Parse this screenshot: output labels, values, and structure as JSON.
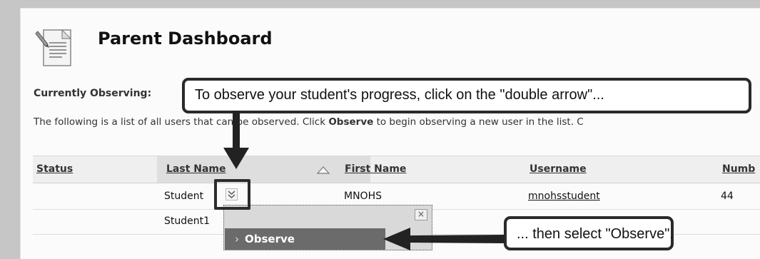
{
  "header": {
    "title": "Parent Dashboard",
    "icon": "document-icon"
  },
  "observing": {
    "label": "Currently Observing:"
  },
  "instructions": {
    "prefix": "The following is a list of all users that can be observed. Click ",
    "action": "Observe",
    "suffix": " to begin observing a new user in the list. C"
  },
  "table": {
    "headers": {
      "status": "Status",
      "last_name": "Last Name",
      "first_name": "First Name",
      "username": "Username",
      "number": "Numb"
    },
    "sort": {
      "column": "last_name",
      "direction": "ascending"
    },
    "rows": [
      {
        "status": "",
        "last_name": "Student",
        "first_name": "MNOHS",
        "username": "mnohsstudent",
        "number": "44"
      },
      {
        "status": "",
        "last_name": "Student1",
        "first_name": "",
        "username": "",
        "number": ""
      }
    ]
  },
  "context_menu": {
    "close": "×",
    "caret": "›",
    "item": "Observe"
  },
  "annotations": {
    "callout_1": "To observe your student's progress, click on the \"double arrow\"...",
    "callout_2": "... then select \"Observe\"."
  },
  "colors": {
    "background": "#c6c6c6",
    "panel": "#fbfbfb",
    "header_row": "#efefef",
    "sorted_column": "#dedede",
    "menu_item": "#6b6b6b",
    "callout_border": "#2a2a2a"
  }
}
